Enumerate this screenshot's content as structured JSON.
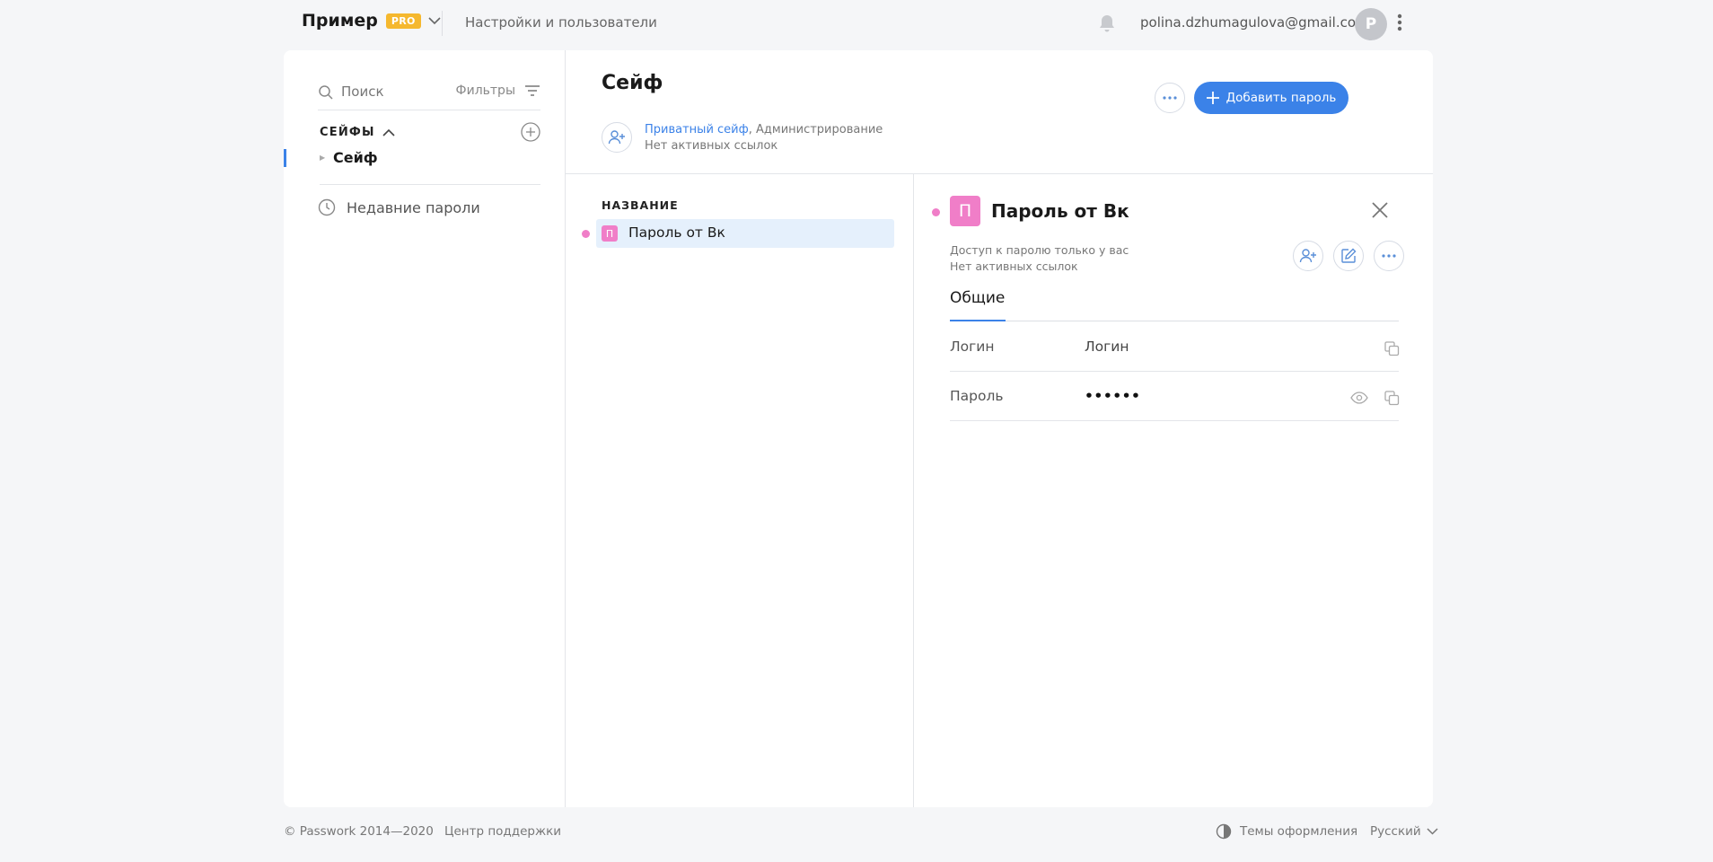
{
  "header": {
    "brand_name": "Пример",
    "pro_badge": "PRO",
    "settings_link": "Настройки и пользователи",
    "user_email": "polina.dzhumagulova@gmail.com",
    "avatar_letter": "P"
  },
  "sidebar": {
    "search_placeholder": "Поиск",
    "filters_label": "Фильтры",
    "safes_title": "СЕЙФЫ",
    "safes": [
      {
        "name": "Сейф",
        "selected": true
      }
    ],
    "recent_label": "Недавние пароли"
  },
  "vault": {
    "title": "Сейф",
    "type_link": "Приватный сейф",
    "role": ", Администрирование",
    "links_status": "Нет активных ссылок",
    "add_password_label": "Добавить пароль"
  },
  "list": {
    "column_header": "НАЗВАНИЕ",
    "items": [
      {
        "badge": "П",
        "name": "Пароль от Вк"
      }
    ]
  },
  "detail": {
    "badge": "П",
    "title": "Пароль от Вк",
    "access_text": "Доступ к паролю только у вас",
    "links_status": "Нет активных ссылок",
    "tab_general": "Общие",
    "fields": [
      {
        "label": "Логин",
        "value": "Логин"
      },
      {
        "label": "Пароль",
        "value": "••••••"
      }
    ]
  },
  "footer": {
    "copyright": "© Passwork 2014—2020",
    "support": "Центр поддержки",
    "themes": "Темы оформления",
    "language": "Русский"
  },
  "colors": {
    "accent": "#3b82e8",
    "pro_badge": "#f5b82e",
    "item_badge": "#f07ec8",
    "selected_row": "#e5f0fc"
  }
}
